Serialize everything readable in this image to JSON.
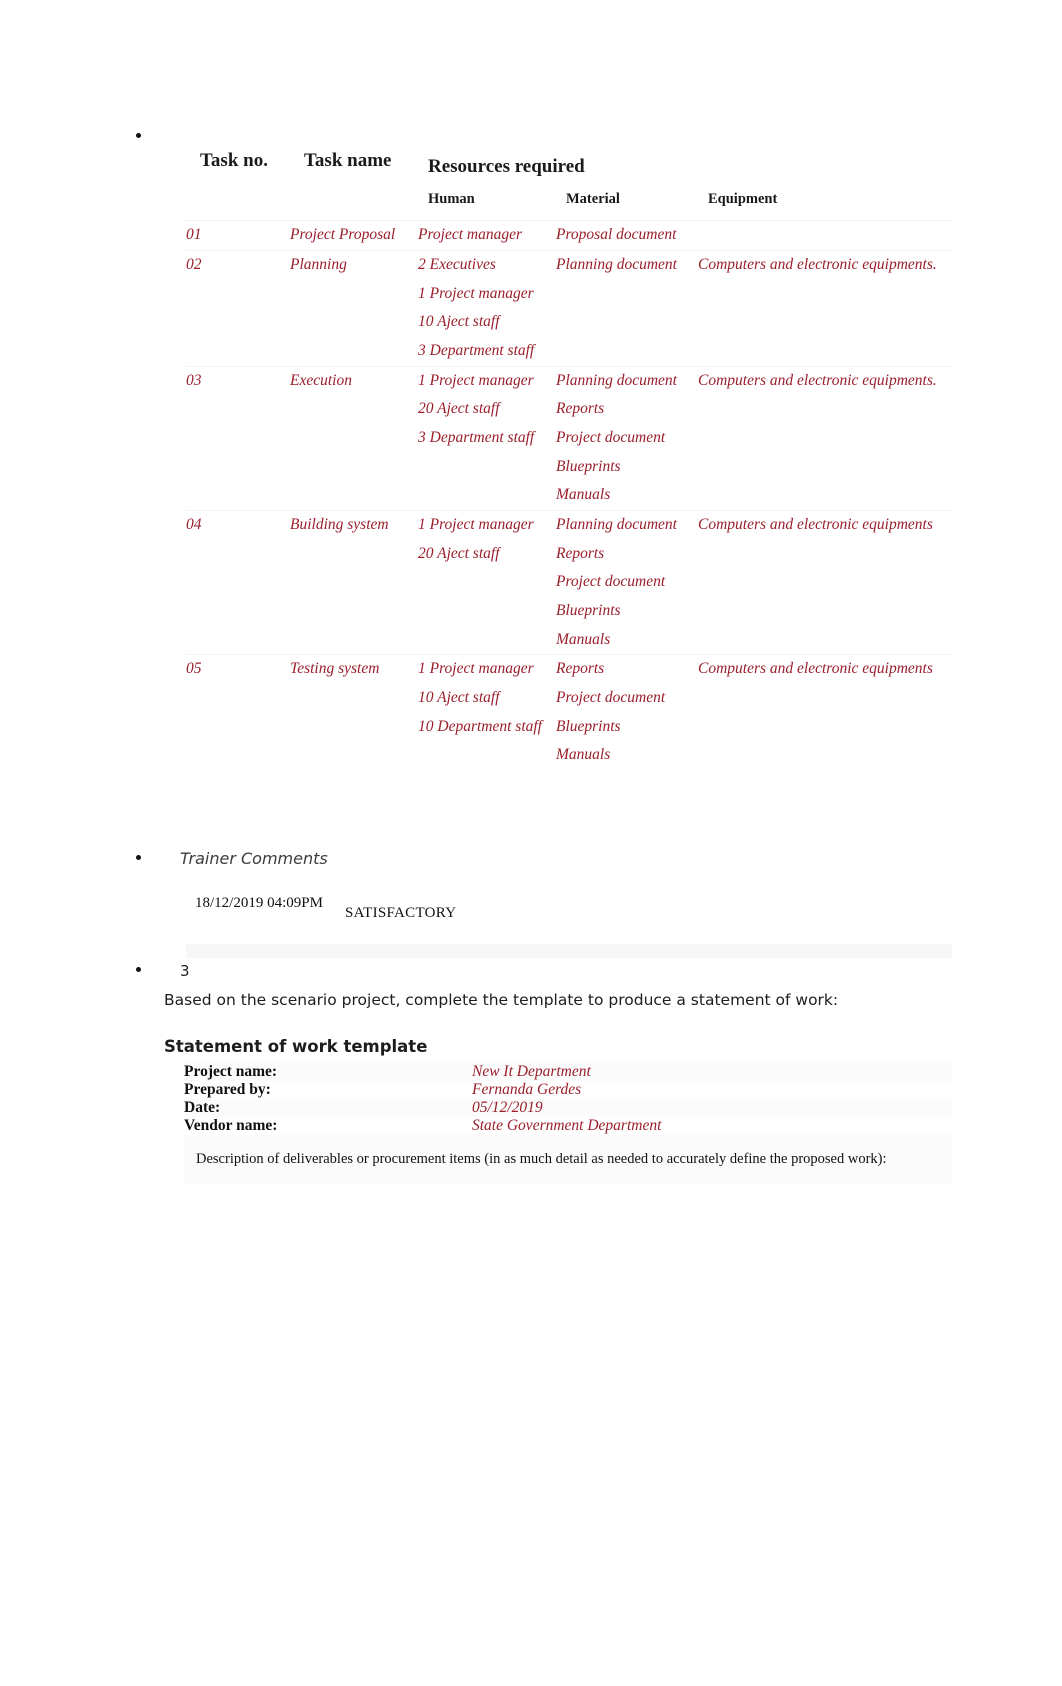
{
  "colors": {
    "accent_red": "#9a1f2b",
    "header_text": "#1a1a1a",
    "body_text": "#1d1d1d",
    "band": "#f7f7f7"
  },
  "resources_table": {
    "headers": {
      "task_no": "Task no.",
      "task_name": "Task name",
      "resources_required": "Resources required",
      "human": "Human",
      "material": "Material",
      "equipment": "Equipment"
    },
    "rows": [
      {
        "task_no": "01",
        "task_name": "Project Proposal",
        "human": [
          "Project manager"
        ],
        "material": [
          "Proposal document"
        ],
        "equipment": []
      },
      {
        "task_no": "02",
        "task_name": "Planning",
        "human": [
          "2 Executives",
          "1 Project manager",
          "10 Aject staff",
          "3 Department staff"
        ],
        "material": [
          "Planning document"
        ],
        "equipment": [
          "Computers and electronic equipments."
        ]
      },
      {
        "task_no": "03",
        "task_name": "Execution",
        "human": [
          "1 Project manager",
          "20 Aject staff",
          "3 Department staff"
        ],
        "material": [
          "Planning document",
          "Reports",
          "Project document",
          "Blueprints",
          "Manuals"
        ],
        "equipment": [
          "Computers and electronic equipments."
        ]
      },
      {
        "task_no": "04",
        "task_name": "Building system",
        "human": [
          "1 Project manager",
          "20 Aject staff"
        ],
        "material": [
          "Planning document",
          "Reports",
          "Project document",
          "Blueprints",
          "Manuals"
        ],
        "equipment": [
          "Computers and electronic equipments"
        ]
      },
      {
        "task_no": "05",
        "task_name": "Testing system",
        "human": [
          "1 Project manager",
          "10 Aject staff",
          "10 Department staff"
        ],
        "material": [
          "Reports",
          "Project document",
          "Blueprints",
          "Manuals"
        ],
        "equipment": [
          "Computers and electronic equipments"
        ]
      }
    ]
  },
  "trainer_comments": {
    "label": "Trainer Comments",
    "date": "18/12/2019 04:09PM",
    "status": "SATISFACTORY"
  },
  "question": {
    "number": "3",
    "text": "Based on the scenario project, complete the template to produce a statement of work:",
    "heading": "Statement of work template"
  },
  "sow_table": {
    "rows": [
      {
        "label": "Project name:",
        "value": "New It Department"
      },
      {
        "label": "Prepared by:",
        "value": "Fernanda Gerdes"
      },
      {
        "label": "Date:",
        "value": "05/12/2019"
      },
      {
        "label": "Vendor name:",
        "value": "State Government Department"
      }
    ],
    "description": "Description of deliverables or procurement items (in as much detail as needed to accurately define the proposed work):"
  }
}
